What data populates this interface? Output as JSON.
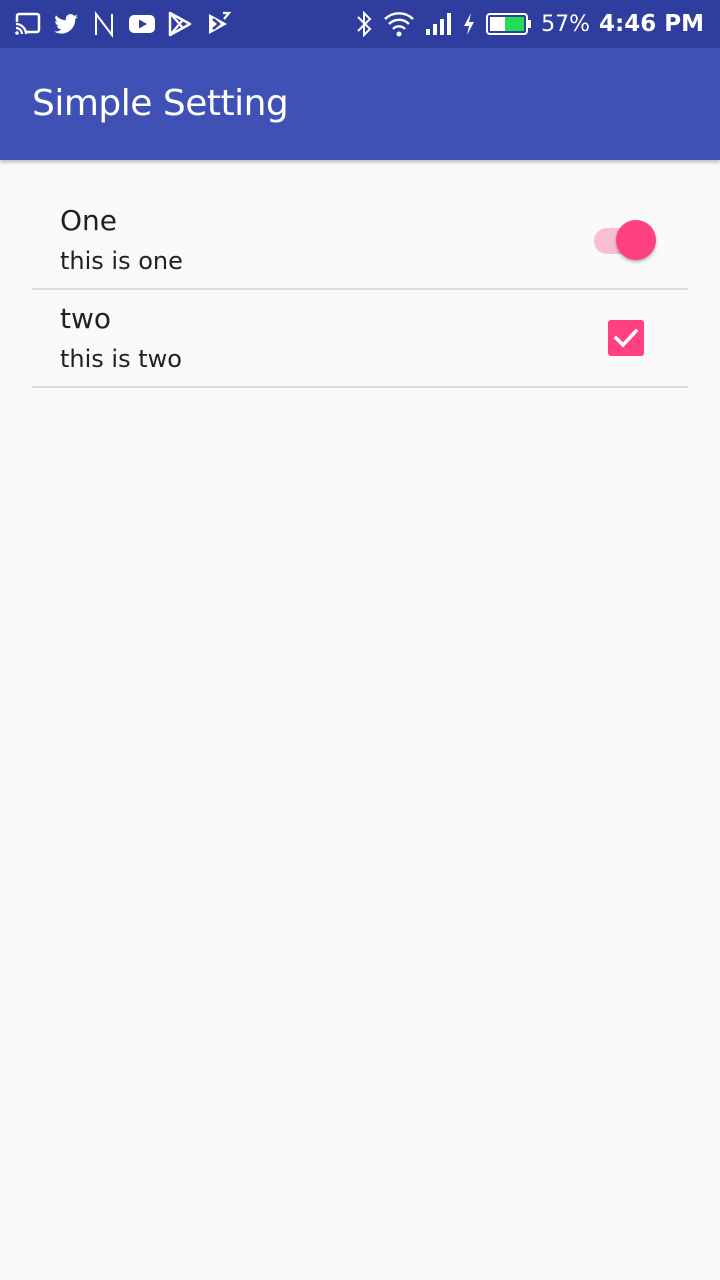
{
  "status_bar": {
    "left_icons": [
      "cast-icon",
      "twitter-icon",
      "n-icon",
      "youtube-icon",
      "play-store-icon",
      "play-movies-icon"
    ],
    "right_icons": [
      "bluetooth-icon",
      "wifi-icon",
      "signal-icon",
      "charging-icon",
      "battery-icon"
    ],
    "battery_percent": "57%",
    "time": "4:46 PM",
    "battery_level": 0.57
  },
  "toolbar": {
    "title": "Simple Setting"
  },
  "preferences": [
    {
      "title": "One",
      "summary": "this is one",
      "control": "switch",
      "checked": true
    },
    {
      "title": "two",
      "summary": "this is two",
      "control": "checkbox",
      "checked": true
    }
  ],
  "colors": {
    "status_bar": "#2f3e9e",
    "toolbar": "#3f51b5",
    "accent": "#ff4081",
    "switch_track": "#f8bfd3",
    "background": "#fafafa",
    "divider": "#dcdcdc",
    "battery_fill": "#22dd55"
  }
}
